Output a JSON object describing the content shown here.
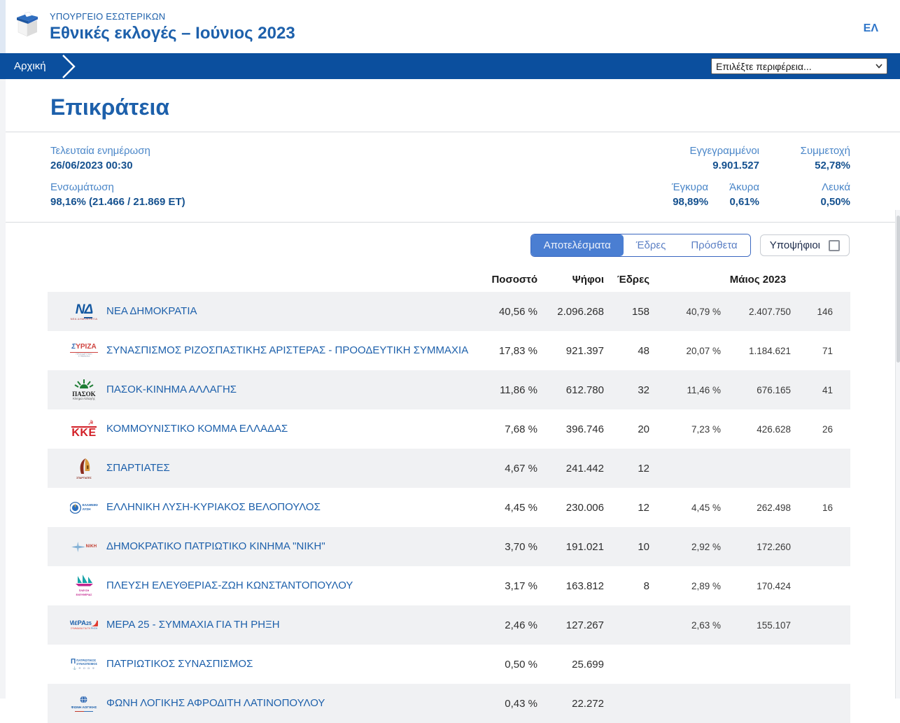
{
  "header": {
    "ministry": "ΥΠΟΥΡΓΕΙΟ ΕΣΩΤΕΡΙΚΩΝ",
    "title": "Εθνικές εκλογές – Ιούνιος 2023",
    "lang": "ΕΛ"
  },
  "breadcrumb": {
    "home": "Αρχική"
  },
  "region_select": {
    "placeholder": "Επιλέξτε περιφέρεια..."
  },
  "page": {
    "title": "Επικράτεια"
  },
  "stats": {
    "last_update_label": "Τελευταία ενημέρωση",
    "last_update_value": "26/06/2023 00:30",
    "integration_label": "Ενσωμάτωση",
    "integration_value": "98,16% (21.466 / 21.869 ΕΤ)",
    "registered_label": "Εγγεγραμμένοι",
    "registered_value": "9.901.527",
    "turnout_label": "Συμμετοχή",
    "turnout_value": "52,78%",
    "valid_label": "Έγκυρα",
    "valid_value": "98,89%",
    "invalid_label": "Άκυρα",
    "invalid_value": "0,61%",
    "blank_label": "Λευκά",
    "blank_value": "0,50%"
  },
  "tabs": {
    "results": "Αποτελέσματα",
    "seats": "Έδρες",
    "extras": "Πρόσθετα",
    "candidates": "Υποψήφιοι"
  },
  "table": {
    "headers": {
      "percent": "Ποσοστό",
      "votes": "Ψήφοι",
      "seats": "Έδρες",
      "may2023": "Μάιος 2023"
    }
  },
  "parties": [
    {
      "name": "ΝΕΑ ΔΗΜΟΚΡΑΤΙΑ",
      "logo": "nd-logo",
      "pct": "40,56 %",
      "votes": "2.096.268",
      "seats": "158",
      "may_pct": "40,79 %",
      "may_votes": "2.407.750",
      "may_seats": "146"
    },
    {
      "name": "ΣΥΝΑΣΠΙΣΜΟΣ ΡΙΖΟΣΠΑΣΤΙΚΗΣ ΑΡΙΣΤΕΡΑΣ - ΠΡΟΟΔΕΥΤΙΚΗ ΣΥΜΜΑΧΙΑ",
      "logo": "syriza-logo",
      "pct": "17,83 %",
      "votes": "921.397",
      "seats": "48",
      "may_pct": "20,07 %",
      "may_votes": "1.184.621",
      "may_seats": "71"
    },
    {
      "name": "ΠΑΣΟΚ-ΚΙΝΗΜΑ ΑΛΛΑΓΗΣ",
      "logo": "pasok-logo",
      "pct": "11,86 %",
      "votes": "612.780",
      "seats": "32",
      "may_pct": "11,46 %",
      "may_votes": "676.165",
      "may_seats": "41"
    },
    {
      "name": "ΚΟΜΜΟΥΝΙΣΤΙΚΟ ΚΟΜΜΑ ΕΛΛΑΔΑΣ",
      "logo": "kke-logo",
      "pct": "7,68 %",
      "votes": "396.746",
      "seats": "20",
      "may_pct": "7,23 %",
      "may_votes": "426.628",
      "may_seats": "26"
    },
    {
      "name": "ΣΠΑΡΤΙΑΤΕΣ",
      "logo": "spartiates-logo",
      "pct": "4,67 %",
      "votes": "241.442",
      "seats": "12",
      "may_pct": "",
      "may_votes": "",
      "may_seats": ""
    },
    {
      "name": "ΕΛΛΗΝΙΚΗ ΛΥΣΗ-ΚΥΡΙΑΚΟΣ ΒΕΛΟΠΟΥΛΟΣ",
      "logo": "elliniki-lysi-logo",
      "pct": "4,45 %",
      "votes": "230.006",
      "seats": "12",
      "may_pct": "4,45 %",
      "may_votes": "262.498",
      "may_seats": "16"
    },
    {
      "name": "ΔΗΜΟΚΡΑΤΙΚΟ ΠΑΤΡΙΩΤΙΚΟ ΚΙΝΗΜΑ \"ΝΙΚΗ\"",
      "logo": "niki-logo",
      "pct": "3,70 %",
      "votes": "191.021",
      "seats": "10",
      "may_pct": "2,92 %",
      "may_votes": "172.260",
      "may_seats": ""
    },
    {
      "name": "ΠΛΕΥΣΗ ΕΛΕΥΘΕΡΙΑΣ-ΖΩΗ ΚΩΝΣΤΑΝΤΟΠΟΥΛΟΥ",
      "logo": "plefsi-logo",
      "pct": "3,17 %",
      "votes": "163.812",
      "seats": "8",
      "may_pct": "2,89 %",
      "may_votes": "170.424",
      "may_seats": ""
    },
    {
      "name": "ΜΕΡΑ 25 - ΣΥΜΜΑΧΙΑ ΓΙΑ ΤΗ ΡΗΞΗ",
      "logo": "mera25-logo",
      "pct": "2,46 %",
      "votes": "127.267",
      "seats": "",
      "may_pct": "2,63 %",
      "may_votes": "155.107",
      "may_seats": ""
    },
    {
      "name": "ΠΑΤΡΙΩΤΙΚΟΣ ΣΥΝΑΣΠΙΣΜΟΣ",
      "logo": "patriotiko-logo",
      "pct": "0,50 %",
      "votes": "25.699",
      "seats": "",
      "may_pct": "",
      "may_votes": "",
      "may_seats": ""
    },
    {
      "name": "ΦΩΝΗ ΛΟΓΙΚΗΣ ΑΦΡΟΔΙΤΗ ΛΑΤΙΝΟΠΟΥΛΟΥ",
      "logo": "foni-logikis-logo",
      "pct": "0,43 %",
      "votes": "22.272",
      "seats": "",
      "may_pct": "",
      "may_votes": "",
      "may_seats": ""
    }
  ],
  "colors": {
    "brand_blue": "#1d60ab",
    "breadcrumb_bg": "#0b4f9e",
    "active_tab": "#4a7ed2",
    "row_alt": "#f0f1f3",
    "label_blue": "#4a86c8",
    "value_navy": "#15518f"
  }
}
